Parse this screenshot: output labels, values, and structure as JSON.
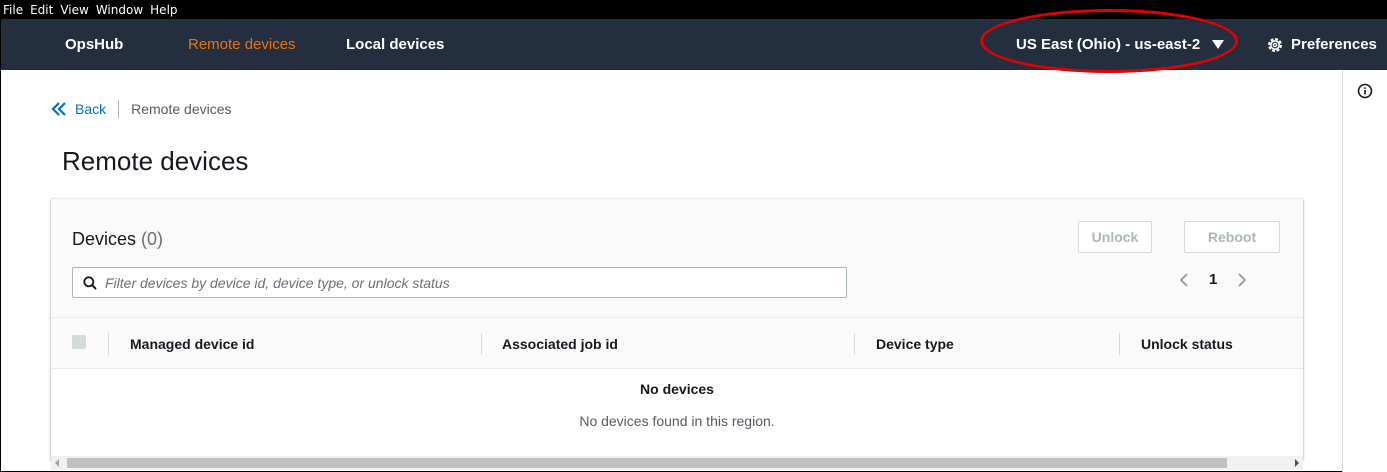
{
  "menubar": {
    "items": [
      "File",
      "Edit",
      "View",
      "Window",
      "Help"
    ]
  },
  "topnav": {
    "brand": "OpsHub",
    "remote_devices": "Remote devices",
    "local_devices": "Local devices",
    "region": "US East (Ohio) - us-east-2",
    "preferences": "Preferences",
    "active_color": "#ec7211",
    "bg_color": "#232f3e"
  },
  "breadcrumb": {
    "back": "Back",
    "current": "Remote devices"
  },
  "page": {
    "title": "Remote devices"
  },
  "devices_panel": {
    "title": "Devices",
    "count": "(0)",
    "unlock_label": "Unlock",
    "reboot_label": "Reboot",
    "filter_placeholder": "Filter devices by device id, device type, or unlock status",
    "page_number": "1",
    "columns": [
      "Managed device id",
      "Associated job id",
      "Device type",
      "Unlock status"
    ],
    "empty_title": "No devices",
    "empty_message": "No devices found in this region."
  },
  "annotation": {
    "highlight_color": "#e30000"
  }
}
